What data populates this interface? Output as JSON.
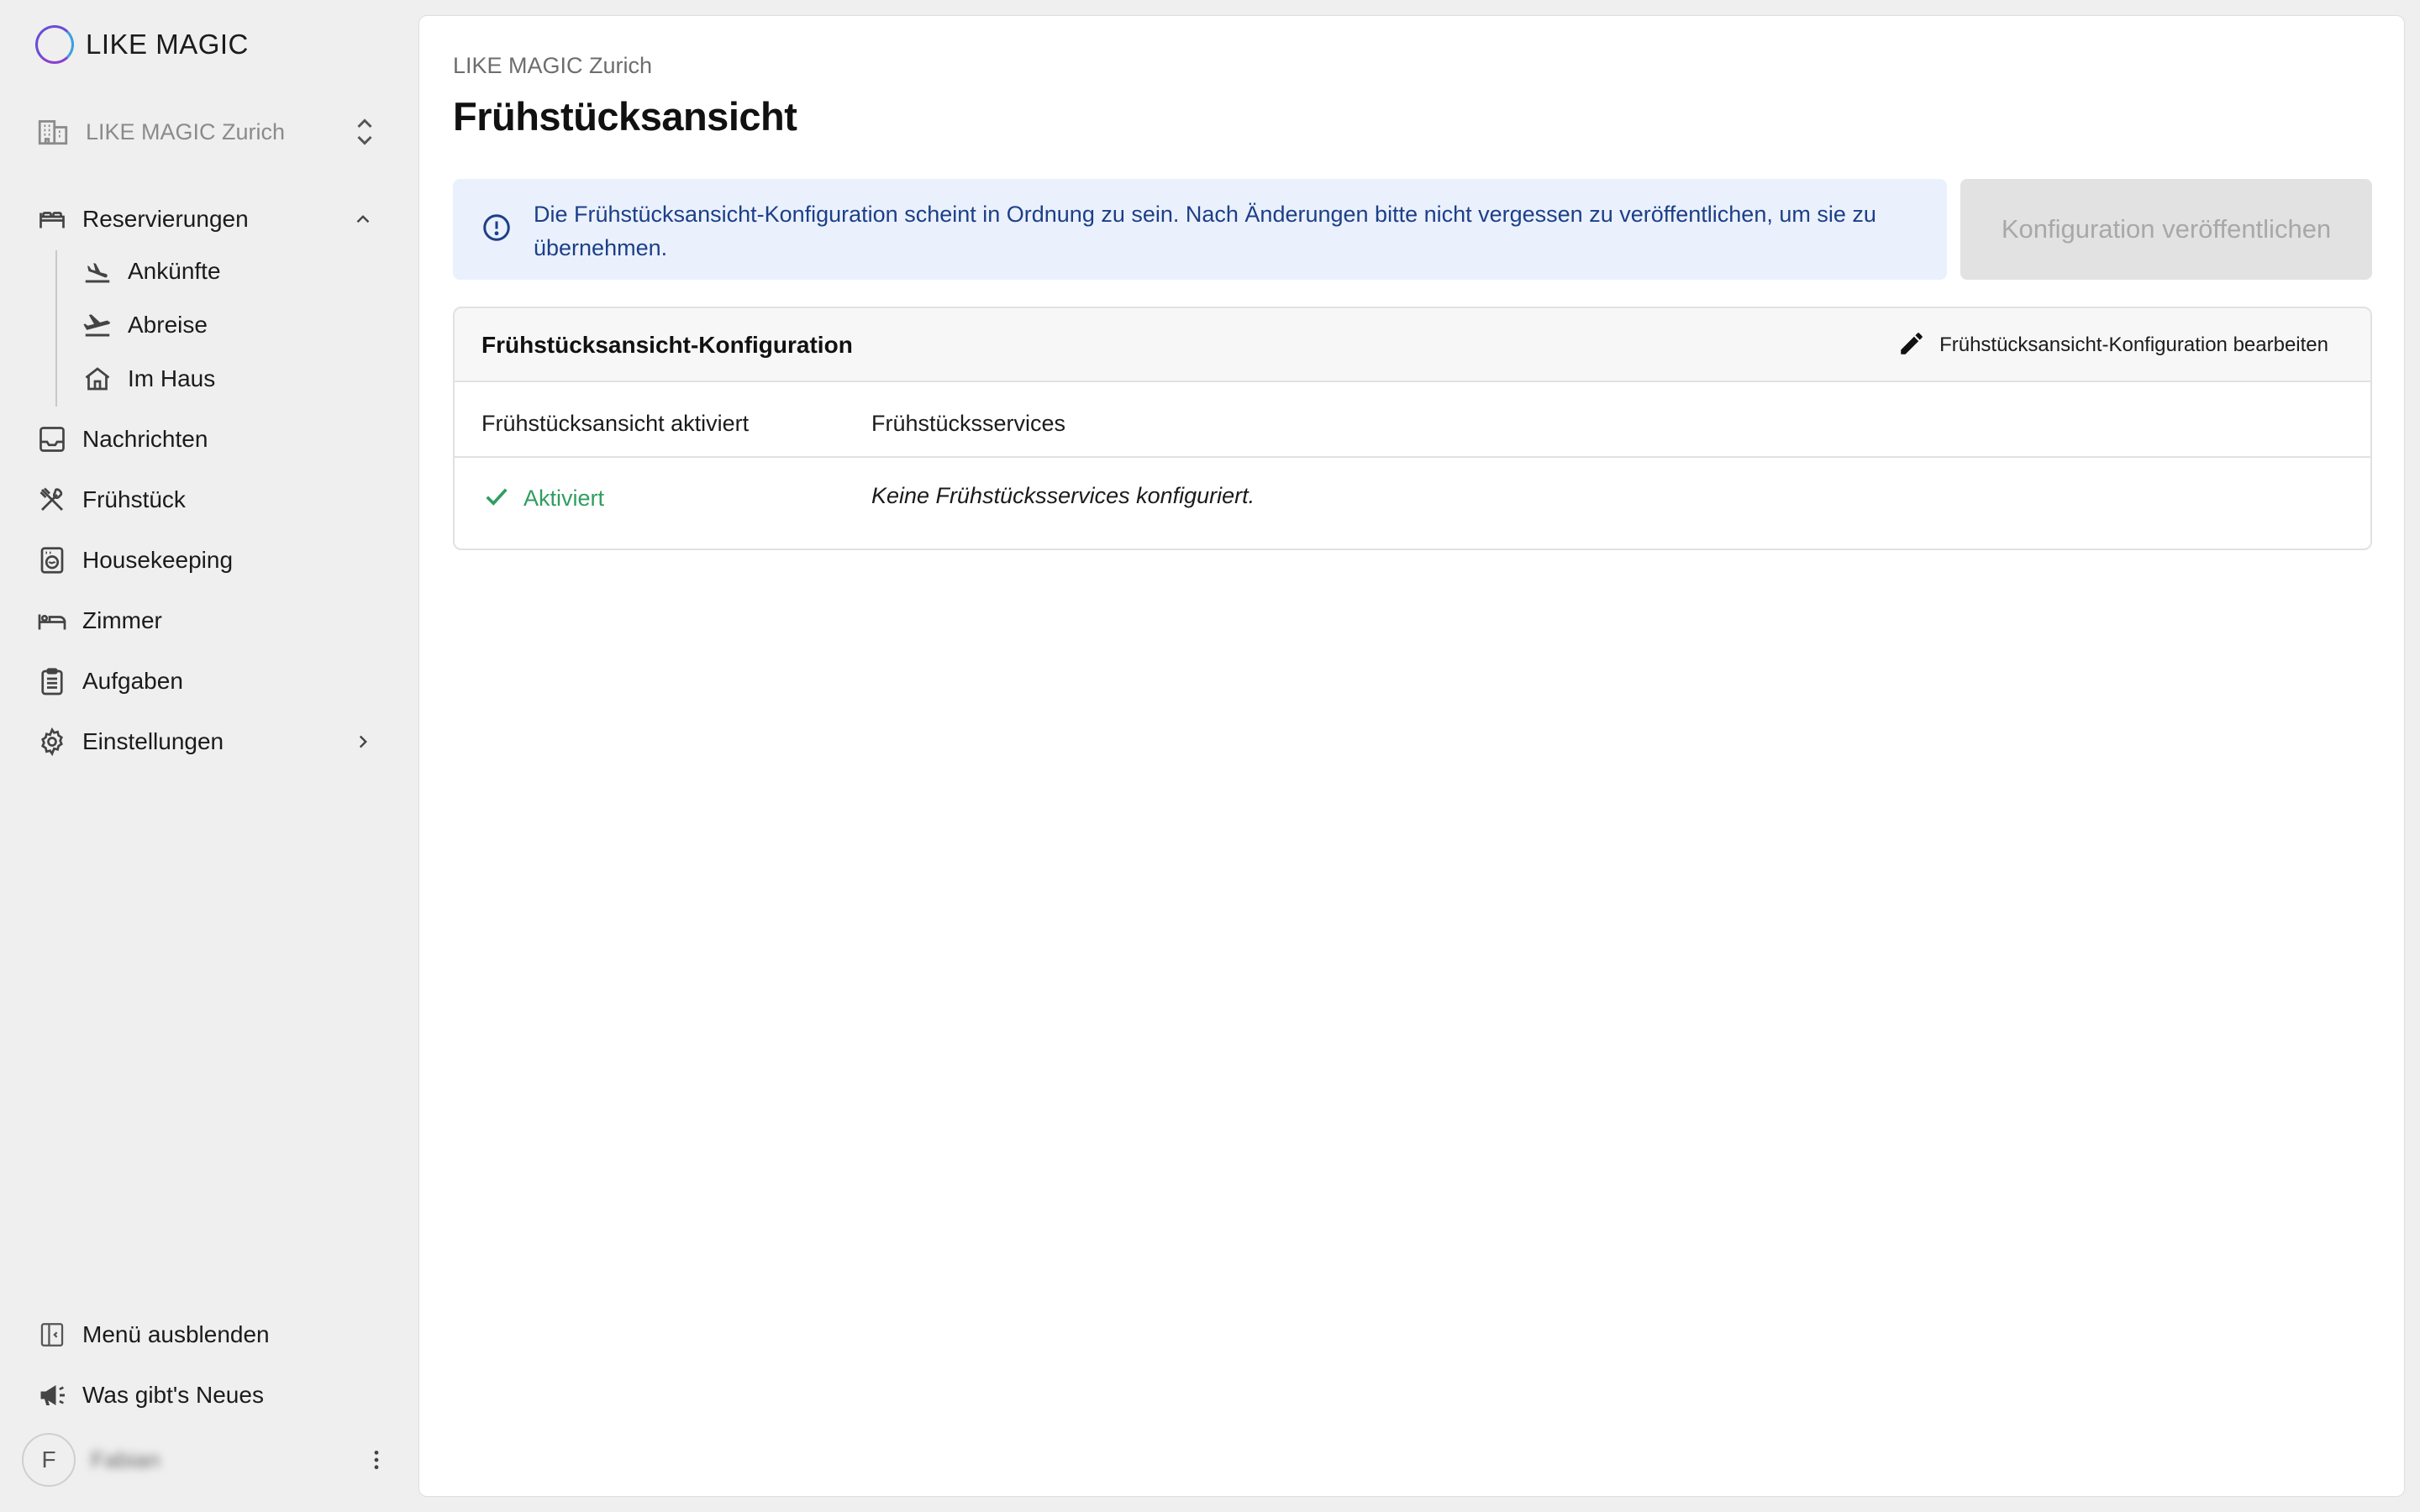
{
  "brand": {
    "name": "LIKE MAGIC"
  },
  "property": {
    "name": "LIKE MAGIC Zurich"
  },
  "nav": {
    "reservations": "Reservierungen",
    "arrivals": "Ankünfte",
    "departures": "Abreise",
    "in_house": "Im Haus",
    "messages": "Nachrichten",
    "breakfast": "Frühstück",
    "housekeeping": "Housekeeping",
    "rooms": "Zimmer",
    "tasks": "Aufgaben",
    "settings": "Einstellungen"
  },
  "footer": {
    "hide_menu": "Menü ausblenden",
    "whats_new": "Was gibt's Neues",
    "user_initial": "F",
    "user_name": "Fabian"
  },
  "page": {
    "breadcrumb": "LIKE MAGIC Zurich",
    "title": "Frühstücksansicht"
  },
  "alert": {
    "message": "Die Frühstücksansicht-Konfiguration scheint in Ordnung zu sein. Nach Änderungen bitte nicht vergessen zu veröffentlichen, um sie zu übernehmen."
  },
  "publish_button": "Konfiguration veröffentlichen",
  "config_card": {
    "title": "Frühstücksansicht-Konfiguration",
    "edit_label": "Frühstücksansicht-Konfiguration bearbeiten",
    "columns": [
      "Frühstücksansicht aktiviert",
      "Frühstücksservices"
    ],
    "row": {
      "status": "Aktiviert",
      "services": "Keine Frühstücksservices konfiguriert."
    }
  },
  "colors": {
    "accent_success": "#2f9e60",
    "alert_bg": "#eaf1fd",
    "alert_text": "#1d3f87",
    "button_disabled_bg": "#e2e2e2"
  }
}
